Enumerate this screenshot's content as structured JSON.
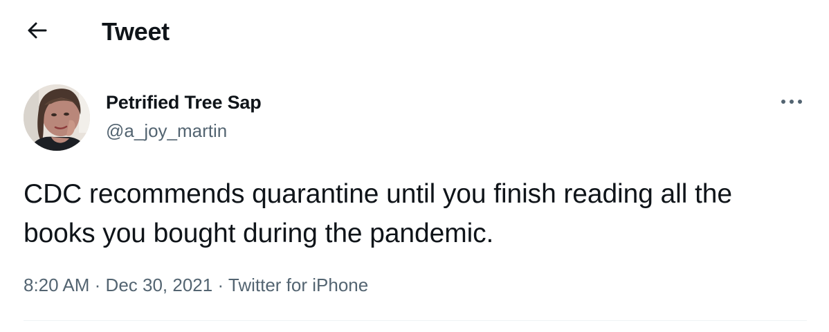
{
  "header": {
    "title": "Tweet"
  },
  "tweet": {
    "author": {
      "display_name": "Petrified Tree Sap",
      "handle": "@a_joy_martin"
    },
    "text": "CDC recommends quarantine until you finish reading all the books you bought during the pandemic.",
    "time": "8:20 AM",
    "separator": "·",
    "date": "Dec 30, 2021",
    "source": "Twitter for iPhone"
  },
  "icons": {
    "back": "arrow-left-icon",
    "more": "more-horizontal-icon"
  },
  "colors": {
    "text_primary": "#0f1419",
    "text_secondary": "#536471",
    "divider": "#eff3f4"
  }
}
